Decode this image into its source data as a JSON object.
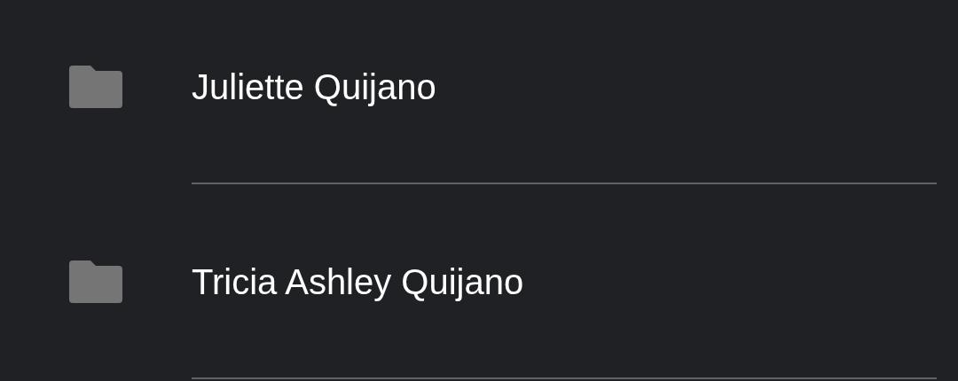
{
  "folders": [
    {
      "name": "Juliette Quijano"
    },
    {
      "name": "Tricia Ashley Quijano"
    }
  ]
}
